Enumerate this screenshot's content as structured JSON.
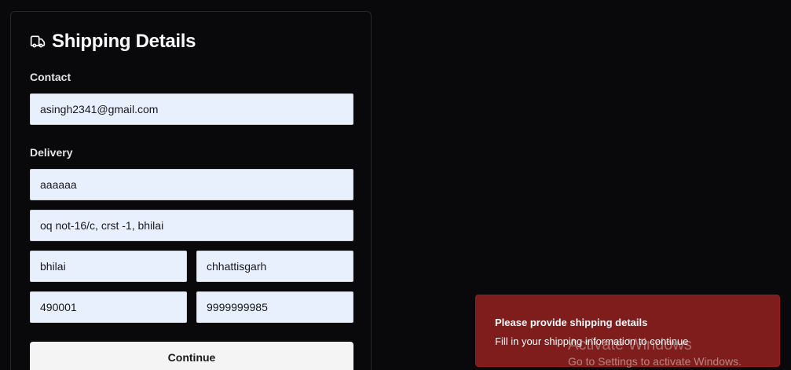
{
  "form": {
    "title": "Shipping Details",
    "title_icon": "truck-icon",
    "contact_label": "Contact",
    "email": "asingh2341@gmail.com",
    "delivery_label": "Delivery",
    "name": "aaaaaa",
    "address": "oq not-16/c, crst -1, bhilai",
    "city": "bhilai",
    "state": "chhattisgarh",
    "pincode": "490001",
    "phone": "9999999985",
    "continue_label": "Continue"
  },
  "toast": {
    "title": "Please provide shipping details",
    "description": "Fill in your shipping information to continue",
    "color": "#7f1d1d"
  },
  "watermark": {
    "line1": "Activate Windows",
    "line2": "Go to Settings to activate Windows."
  }
}
